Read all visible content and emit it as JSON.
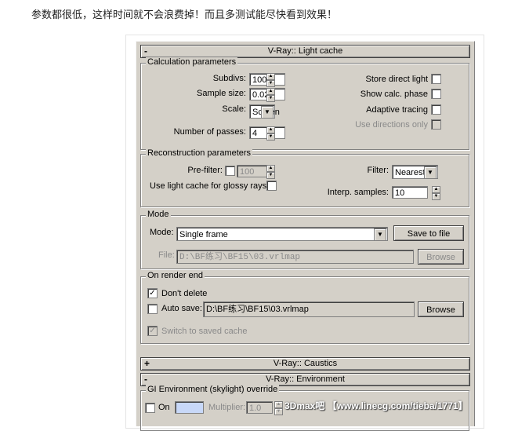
{
  "caption": "参数都很低，这样时间就不会浪费掉！而且多测试能尽快看到效果！",
  "rollouts": {
    "light_cache": {
      "sign": "-",
      "title": "V-Ray:: Light cache"
    },
    "caustics": {
      "sign": "+",
      "title": "V-Ray:: Caustics"
    },
    "environment": {
      "sign": "-",
      "title": "V-Ray:: Environment"
    }
  },
  "calc": {
    "legend": "Calculation parameters",
    "subdivs_label": "Subdivs:",
    "subdivs_value": "100",
    "sample_size_label": "Sample size:",
    "sample_size_value": "0.02",
    "scale_label": "Scale:",
    "scale_value": "Screen",
    "passes_label": "Number of passes:",
    "passes_value": "4",
    "store_direct": "Store direct light",
    "show_calc": "Show calc. phase",
    "adaptive": "Adaptive tracing",
    "use_directions": "Use directions only"
  },
  "recon": {
    "legend": "Reconstruction parameters",
    "prefilter_label": "Pre-filter:",
    "prefilter_value": "100",
    "glossy_label": "Use light cache for glossy rays",
    "filter_label": "Filter:",
    "filter_value": "Nearest",
    "interp_label": "Interp. samples:",
    "interp_value": "10"
  },
  "mode": {
    "legend": "Mode",
    "mode_label": "Mode:",
    "mode_value": "Single frame",
    "save_button": "Save to file",
    "file_label": "File:",
    "file_value": "D:\\BF练习\\BF15\\03.vrlmap",
    "browse": "Browse"
  },
  "render_end": {
    "legend": "On render end",
    "dont_delete": "Don't delete",
    "auto_save": "Auto save:",
    "auto_save_path": "D:\\BF练习\\BF15\\03.vrlmap",
    "browse": "Browse",
    "switch_cache": "Switch to saved cache"
  },
  "env": {
    "legend": "GI Environment (skylight) override",
    "on_label": "On",
    "multiplier_label": "Multiplier:",
    "multiplier_value": "1.0",
    "swatch_color": "#c8d8f8"
  },
  "watermark": "3Dmax吧 【www.linecg.com/tieba/1771】"
}
